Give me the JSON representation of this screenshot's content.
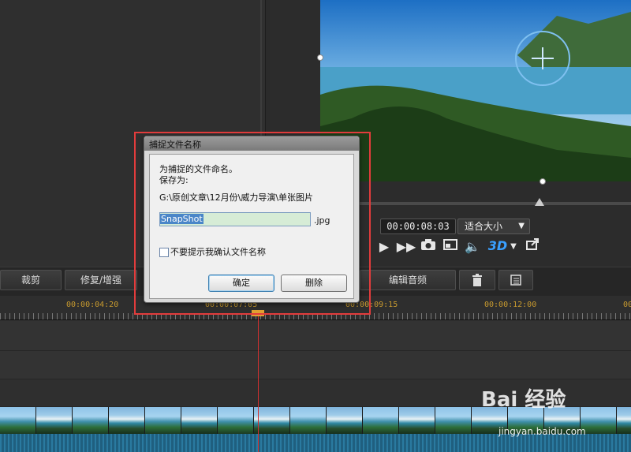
{
  "dialog": {
    "title": "捕捉文件名称",
    "prompt": "为捕捉的文件命名。",
    "save_as_label": "保存为:",
    "save_path": "G:\\原创文章\\12月份\\威力导演\\单张图片",
    "filename_value": "SnapShot",
    "extension": ".jpg",
    "dont_ask_label": "不要提示我确认文件名称",
    "dont_ask_checked": false,
    "ok_label": "确定",
    "delete_label": "删除"
  },
  "preview": {
    "timecode": "00:00:08:03",
    "fit_option": "适合大小",
    "mode_3d": "3D"
  },
  "toolbar": {
    "trim_label": "裁剪",
    "fix_enhance_label": "修复/增强",
    "edit_audio_label": "编辑音频"
  },
  "timeline": {
    "ticks": [
      "00:00:04:20",
      "00:00:07:05",
      "00:00:09:15",
      "00:00:12:00"
    ],
    "partial_timecode": "00"
  },
  "watermark": {
    "brand": "Bai 经验",
    "url": "jingyan.baidu.com"
  },
  "colors": {
    "dialog_outline": "#e23c3c",
    "timecode_orange": "#c89a2f",
    "playhead": "#d03030",
    "accent_3d": "#3aa0ff"
  }
}
